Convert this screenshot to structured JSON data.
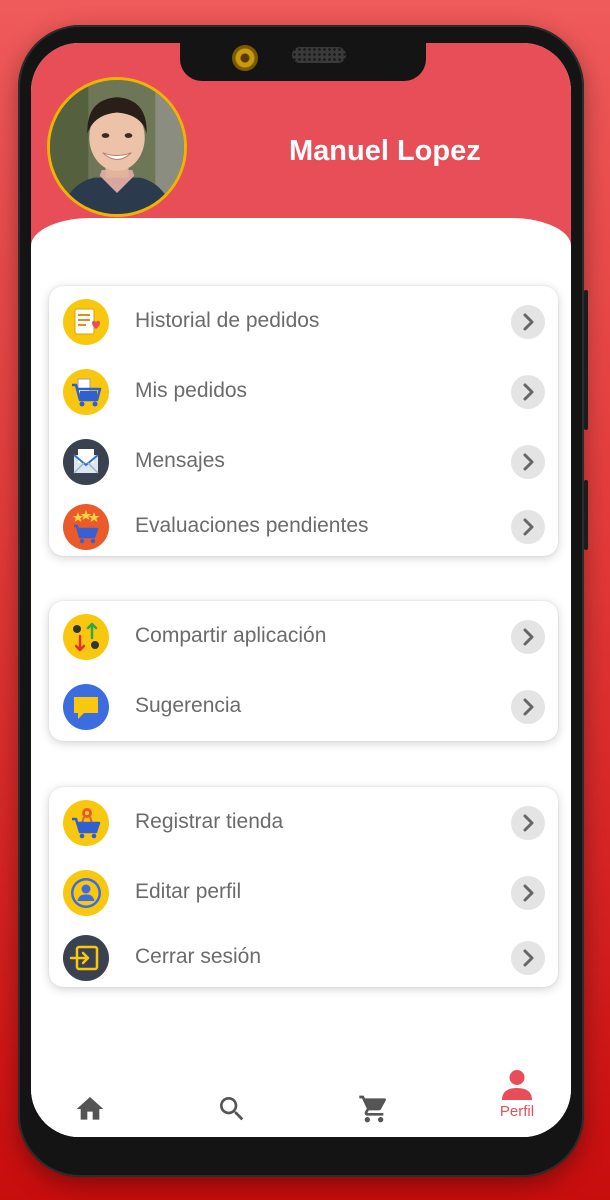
{
  "user": {
    "name": "Manuel Lopez"
  },
  "menu_groups": [
    {
      "items": [
        {
          "label": "Historial de pedidos",
          "icon": "order-history-icon"
        },
        {
          "label": "Mis pedidos",
          "icon": "shopping-cart-icon"
        },
        {
          "label": "Mensajes",
          "icon": "envelope-icon"
        },
        {
          "label": "Evaluaciones pendientes",
          "icon": "star-rating-icon"
        }
      ]
    },
    {
      "items": [
        {
          "label": "Compartir aplicación",
          "icon": "share-arrows-icon"
        },
        {
          "label": "Sugerencia",
          "icon": "chat-bubble-icon"
        }
      ]
    },
    {
      "items": [
        {
          "label": "Registrar tienda",
          "icon": "store-cart-icon"
        },
        {
          "label": "Editar perfil",
          "icon": "profile-icon"
        },
        {
          "label": "Cerrar sesión",
          "icon": "logout-icon"
        }
      ]
    }
  ],
  "bottom_nav": {
    "items": [
      {
        "icon": "home-icon",
        "label": ""
      },
      {
        "icon": "search-icon",
        "label": ""
      },
      {
        "icon": "cart-icon",
        "label": ""
      },
      {
        "icon": "person-icon",
        "label": "Perfil",
        "active": true
      }
    ]
  },
  "colors": {
    "header": "#e84e58",
    "background_top": "#ef5a5a",
    "background_bottom": "#c80d0d",
    "menu_text": "#6b6b6b",
    "nav_inactive": "#555555",
    "nav_active": "#e84e58",
    "avatar_ring": "#f0b400"
  }
}
